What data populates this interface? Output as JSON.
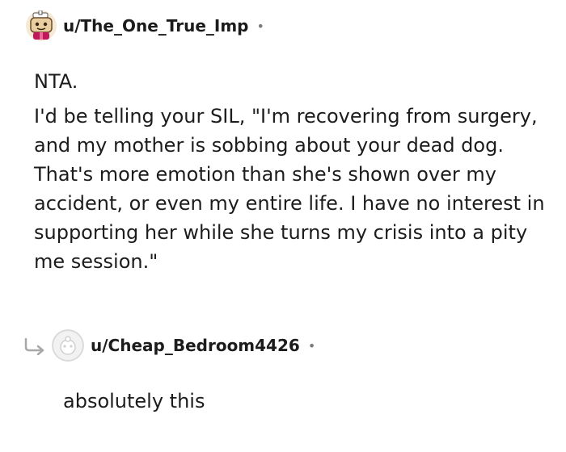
{
  "comment": {
    "username": "u/The_One_True_Imp",
    "separator": "•",
    "paragraphs": [
      "NTA.",
      "I'd be telling your SIL, \"I'm recovering from surgery, and my mother is sobbing about your dead dog. That's more emotion than she's shown over my accident, or even my entire life. I have no interest in supporting her while she turns my crisis into a pity me session.\""
    ]
  },
  "reply": {
    "username": "u/Cheap_Bedroom4426",
    "separator": "•",
    "text": "absolutely this"
  },
  "colors": {
    "text": "#1c1c1c",
    "muted": "#7c7c7c",
    "reply_arrow": "#a8a8a8",
    "avatar_frame": "#d9d9d9"
  }
}
